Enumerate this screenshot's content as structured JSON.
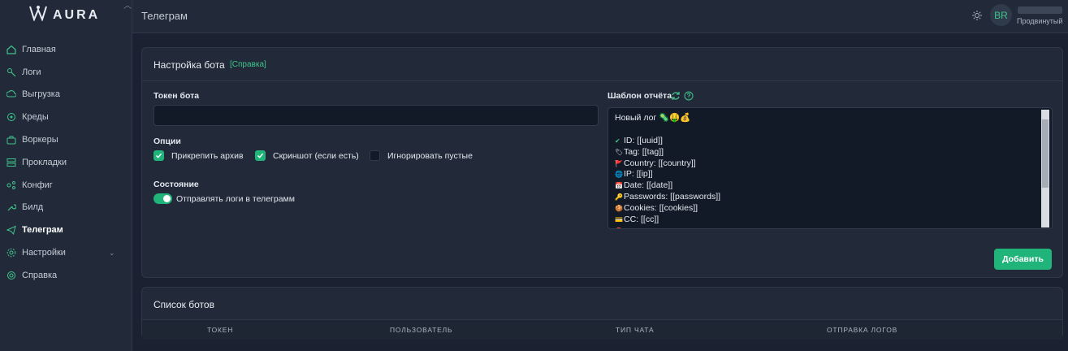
{
  "app": {
    "logo_text": "AURA"
  },
  "sidebar": {
    "items": [
      {
        "label": "Главная",
        "icon": "home-icon"
      },
      {
        "label": "Логи",
        "icon": "logs-icon"
      },
      {
        "label": "Выгрузка",
        "icon": "export-icon"
      },
      {
        "label": "Креды",
        "icon": "credentials-icon"
      },
      {
        "label": "Воркеры",
        "icon": "workers-icon"
      },
      {
        "label": "Прокладки",
        "icon": "proxy-icon"
      },
      {
        "label": "Конфиг",
        "icon": "config-icon"
      },
      {
        "label": "Билд",
        "icon": "build-icon"
      },
      {
        "label": "Телеграм",
        "icon": "telegram-icon",
        "active": true
      },
      {
        "label": "Настройки",
        "icon": "settings-icon",
        "has_submenu": true
      },
      {
        "label": "Справка",
        "icon": "help-icon"
      }
    ]
  },
  "header": {
    "title": "Телеграм",
    "avatar_initials": "BR",
    "user_role": "Продвинутый"
  },
  "bot_settings": {
    "title": "Настройка бота",
    "help_link": "[Справка]",
    "token_label": "Токен бота",
    "token_value": "",
    "options_label": "Опции",
    "options": [
      {
        "label": "Прикрепить архив",
        "checked": true
      },
      {
        "label": "Скриншот (если есть)",
        "checked": true
      },
      {
        "label": "Игнорировать пустые",
        "checked": false
      }
    ],
    "state_label": "Состояние",
    "send_logs_label": "Отправлять логи в телеграмм",
    "send_logs_enabled": true,
    "template_label": "Шаблон отчёта",
    "template_lines": [
      {
        "emoji": "",
        "text": "Новый лог 🦠🤑💰"
      },
      {
        "emoji": "",
        "text": ""
      },
      {
        "emoji": "✔",
        "text": "ID: [[uuid]]"
      },
      {
        "emoji": "🏷",
        "text": "Tag: [[tag]]"
      },
      {
        "emoji": "🚩",
        "text": "Country: [[country]]"
      },
      {
        "emoji": "🌐",
        "text": "IP: [[ip]]"
      },
      {
        "emoji": "📅",
        "text": "Date: [[date]]"
      },
      {
        "emoji": "🔑",
        "text": "Passwords: [[passwords]]"
      },
      {
        "emoji": "🍪",
        "text": "Cookies: [[cookies]]"
      },
      {
        "emoji": "💳",
        "text": "CC: [[cc]]"
      },
      {
        "emoji": "🔴",
        "text": ""
      }
    ],
    "add_button": "Добавить"
  },
  "bots_list": {
    "title": "Список ботов",
    "columns": [
      "ТОКЕН",
      "ПОЛЬЗОВАТЕЛЬ",
      "ТИП ЧАТА",
      "ОТПРАВКА ЛОГОВ"
    ]
  },
  "colors": {
    "accent": "#20b37a",
    "background": "#1b2130",
    "panel": "#222a39"
  }
}
